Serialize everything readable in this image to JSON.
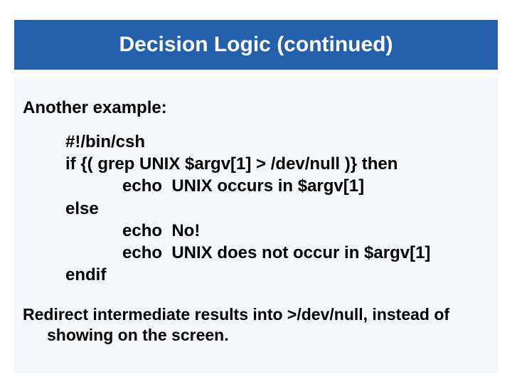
{
  "title": "Decision Logic (continued)",
  "intro": "Another example:",
  "code": {
    "l1": "#!/bin/csh",
    "l2": "if {( grep UNIX $argv[1] > /dev/null )} then",
    "l3": "echo  UNIX occurs in $argv[1]",
    "l4": "else",
    "l5": "echo  No!",
    "l6": "echo  UNIX does not occur in $argv[1]",
    "l7": "endif"
  },
  "footer": "Redirect intermediate results into >/dev/null, instead of showing on the screen."
}
